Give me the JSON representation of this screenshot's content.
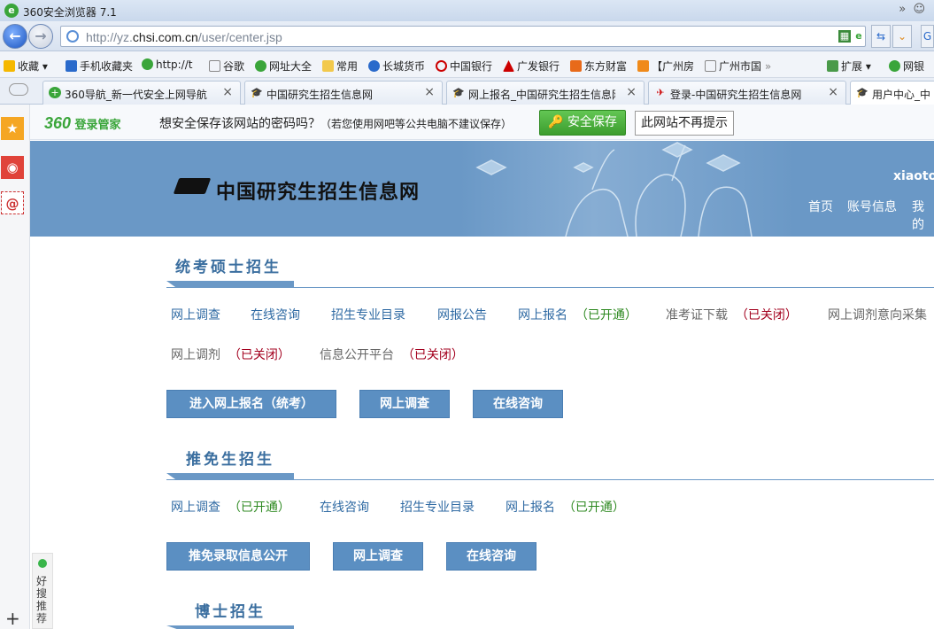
{
  "window": {
    "title": "360安全浏览器 7.1",
    "logo": "e"
  },
  "address": {
    "url_prefix": "http://yz.",
    "url_host": "chsi.com.cn",
    "url_path": "/user/center.jsp"
  },
  "favorites": [
    {
      "label": "收藏",
      "icon": "star-icon"
    },
    {
      "label": "手机收藏夹",
      "icon": "phone-icon"
    },
    {
      "label": "http://t",
      "icon": "plus-icon"
    },
    {
      "label": "谷歌",
      "icon": "page-icon"
    },
    {
      "label": "网址大全",
      "icon": "plus-icon"
    },
    {
      "label": "常用",
      "icon": "folder-icon"
    },
    {
      "label": "长城货币",
      "icon": "page-icon"
    },
    {
      "label": "中国银行",
      "icon": "bank-icon"
    },
    {
      "label": "广发银行",
      "icon": "bank-icon"
    },
    {
      "label": "东方财富",
      "icon": "page-icon"
    },
    {
      "label": "【广州房",
      "icon": "house-icon"
    },
    {
      "label": "广州市国",
      "icon": "page-icon"
    },
    {
      "label": "扩展",
      "icon": "grid-icon"
    },
    {
      "label": "网银",
      "icon": "shield-icon"
    }
  ],
  "tabs": [
    {
      "label": "360导航_新一代安全上网导航",
      "icon": "plus-icon"
    },
    {
      "label": "中国研究生招生信息网",
      "icon": "cap-icon"
    },
    {
      "label": "网上报名_中国研究生招生信息网",
      "icon": "cap-icon"
    },
    {
      "label": "登录-中国研究生招生信息网",
      "icon": "cap-icon"
    },
    {
      "label": "用户中心_中",
      "icon": "cap-icon"
    }
  ],
  "pwbar": {
    "brand_num": "360",
    "brand_text": "登录管家",
    "question": "想安全保存该网站的密码吗？",
    "hint": "（若您使用网吧等公共电脑不建议保存）",
    "save_label": "安全保存",
    "never_label": "此网站不再提示"
  },
  "haosou": {
    "label": "好搜推荐"
  },
  "banner": {
    "site_name": "中国研究生招生信息网",
    "username": "xiaoton",
    "nav": [
      "首页",
      "账号信息",
      "我的"
    ]
  },
  "sections": {
    "master": {
      "title": "统考硕士招生",
      "row1": [
        {
          "label": "网上调查"
        },
        {
          "label": "在线咨询"
        },
        {
          "label": "招生专业目录"
        },
        {
          "label": "网报公告"
        },
        {
          "label": "网上报名",
          "status": "（已开通）"
        },
        {
          "label": "准考证下载",
          "status": "（已关闭）"
        },
        {
          "label": "网上调剂意向采集"
        }
      ],
      "row2": [
        {
          "label": "网上调剂",
          "status": "（已关闭）"
        },
        {
          "label": "信息公开平台",
          "status": "（已关闭）"
        }
      ],
      "buttons": [
        "进入网上报名（统考）",
        "网上调查",
        "在线咨询"
      ]
    },
    "recommend": {
      "title": "推免生招生",
      "row1": [
        {
          "label": "网上调查",
          "status": "（已开通）"
        },
        {
          "label": "在线咨询"
        },
        {
          "label": "招生专业目录"
        },
        {
          "label": "网上报名",
          "status": "（已开通）"
        }
      ],
      "buttons": [
        "推免录取信息公开",
        "网上调查",
        "在线咨询"
      ]
    },
    "phd": {
      "title": "博士招生"
    }
  }
}
